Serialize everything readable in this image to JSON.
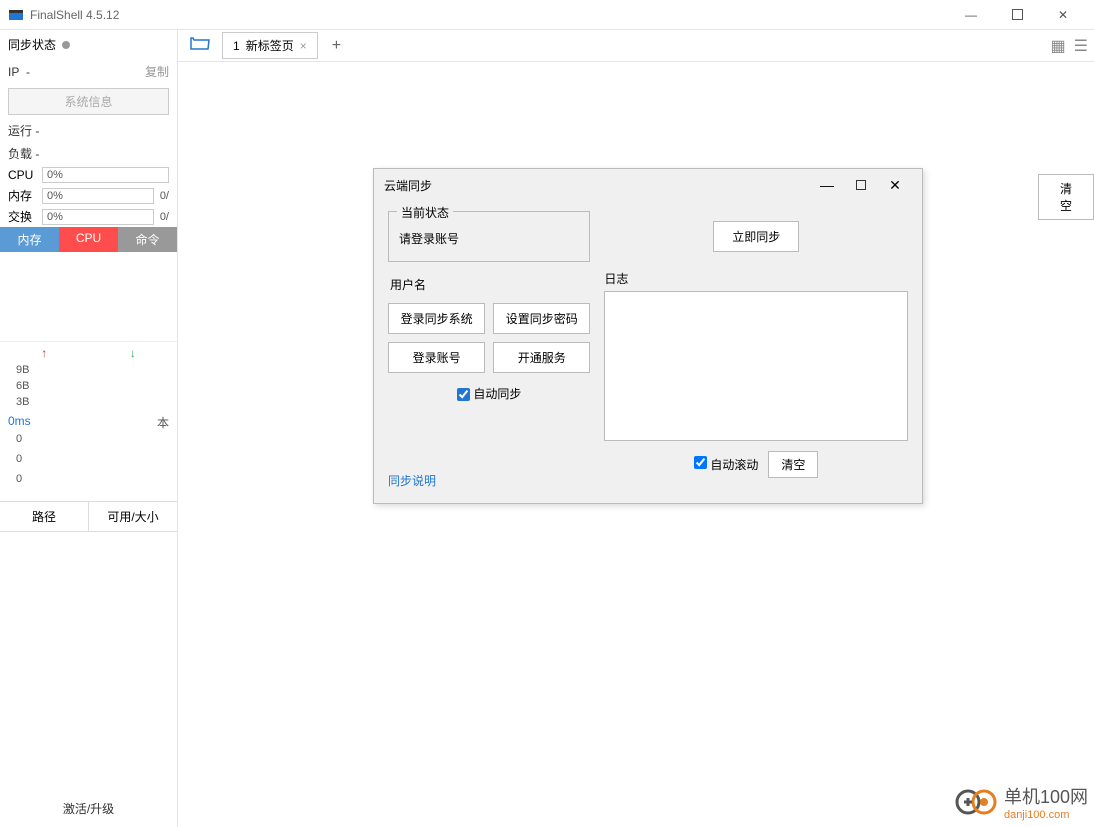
{
  "window": {
    "title": "FinalShell 4.5.12"
  },
  "sidebar": {
    "sync_status": "同步状态",
    "ip_label": "IP",
    "ip_value": "-",
    "copy": "复制",
    "system_info": "系统信息",
    "running": "运行 -",
    "load": "负载 -",
    "cpu_label": "CPU",
    "cpu_pct": "0%",
    "mem_label": "内存",
    "mem_pct": "0%",
    "mem_extra": "0/",
    "swap_label": "交换",
    "swap_pct": "0%",
    "swap_extra": "0/",
    "tab_mem": "内存",
    "tab_cpu": "CPU",
    "tab_cmd": "命令",
    "scale_9b": "9B",
    "scale_6b": "6B",
    "scale_3b": "3B",
    "ms": "0ms",
    "local": "本",
    "zero1": "0",
    "zero2": "0",
    "zero3": "0",
    "path": "路径",
    "avail_size": "可用/大小",
    "activate": "激活/升级"
  },
  "tabbar": {
    "tab1_num": "1",
    "tab1_label": "新标签页"
  },
  "content": {
    "clear": "清空"
  },
  "dialog": {
    "title": "云端同步",
    "current_status_legend": "当前状态",
    "login_prompt": "请登录账号",
    "username": "用户名",
    "btn_login_sync": "登录同步系统",
    "btn_set_pwd": "设置同步密码",
    "btn_login_acct": "登录账号",
    "btn_open_service": "开通服务",
    "auto_sync": "自动同步",
    "sync_help": "同步说明",
    "sync_now": "立即同步",
    "log_label": "日志",
    "auto_scroll": "自动滚动",
    "clear": "清空"
  },
  "watermark": {
    "name": "单机100网",
    "domain": "danji100.com"
  }
}
